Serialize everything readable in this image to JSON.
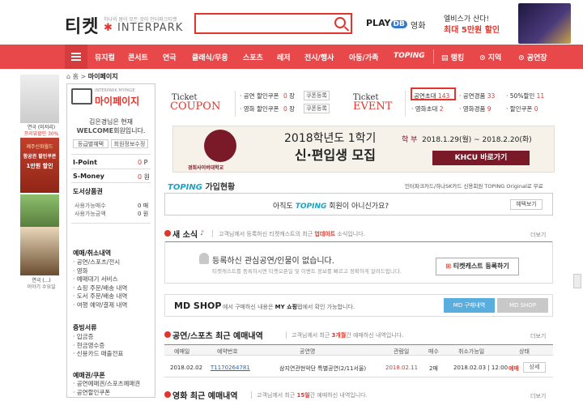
{
  "header": {
    "logo": "티켓",
    "logo_sub": "하나의 몸이 모든 것이 인터파크티켓",
    "logo_brand": "INTERPARK",
    "playdb": "PLAY",
    "playdb_badge": "DB",
    "movie": "영화",
    "ad_line1": "엘비스가 산다!",
    "ad_line2": "최대 5만원 할인"
  },
  "nav": {
    "items": [
      "뮤지컬",
      "콘서트",
      "연극",
      "클래식/무용",
      "스포츠",
      "레저",
      "전시/행사",
      "아동/가족",
      "TOPING"
    ],
    "right": [
      "랭킹",
      "지역",
      "공연장"
    ]
  },
  "breadcrumb": {
    "home": "홈",
    "current": "마이페이지"
  },
  "mypage": {
    "title_small": "INTERPARK MYPAGE",
    "title": "마이페이지",
    "user_line": "김은경님은 현재",
    "grade": "WELCOME",
    "grade_suffix": "회원입니다.",
    "btn1": "등급별혜택",
    "btn2": "회원정보수정",
    "ipoint_label": "I-Point",
    "ipoint_value": "0",
    "ipoint_unit": "P",
    "smoney_label": "S-Money",
    "smoney_value": "0",
    "smoney_unit": "원",
    "voucher_label": "도서상품권",
    "voucher_value": "0",
    "avail_label": "사용가능매수",
    "avail_value": "0",
    "avail_unit": "매",
    "amount_label": "사용가능금액",
    "amount_value": "0",
    "amount_unit": "원",
    "menu_sections": [
      {
        "title": "예매/취소내역",
        "items": [
          "공연/스포츠/전시",
          "영화",
          "예매대기 서비스",
          "쇼핑 주문/배송 내역",
          "도서 주문/배송 내역",
          "여행 예약/결제 내역"
        ]
      },
      {
        "title": "증빙서류",
        "items": [
          "입금증",
          "현금영수증",
          "신용카드 매출전표"
        ]
      },
      {
        "title": "예매권/쿠폰",
        "items": [
          "공연예매권/스포츠예매권",
          "공연할인쿠폰"
        ]
      }
    ]
  },
  "left_banners": {
    "b1_line1": "연극 (미저리)",
    "b1_line2": "프리뷰할인 30%",
    "b2_line1": "제주신화월드",
    "b2_line2": "항공권 할인쿠폰",
    "b2_line3": "1만원 할인",
    "b4_line1": "연극 (...)",
    "b4_line2": "이야기 수요일"
  },
  "coupon": {
    "title1": "Ticket",
    "title2": "COUPON",
    "rows": [
      {
        "label": "공연 할인쿠폰",
        "value": "0",
        "unit": "장",
        "btn": "쿠폰등록"
      },
      {
        "label": "영화 할인쿠폰",
        "value": "0",
        "unit": "장",
        "btn": "쿠폰등록"
      }
    ]
  },
  "event": {
    "title1": "Ticket",
    "title2": "EVENT",
    "items": [
      {
        "label": "공연초대",
        "value": "143"
      },
      {
        "label": "공연경품",
        "value": "33"
      },
      {
        "label": "50%할인",
        "value": "11"
      },
      {
        "label": "영화초대",
        "value": "2"
      },
      {
        "label": "영화경품",
        "value": "9"
      },
      {
        "label": "할인쿠폰",
        "value": "0"
      }
    ]
  },
  "banner": {
    "title": "2018학년도 1학기",
    "subtitle": "신·편입생 모집",
    "school": "경희사이버대학교",
    "school_en": "KYUNG HEE CYBER UNIVERSITY",
    "date_label": "학 부",
    "date": "2018.1.29(월) ~ 2018.2.20(화)",
    "cta": "KHCU 바로가기"
  },
  "toping": {
    "title_brand": "TOPING",
    "title": "가입현황",
    "right_text": "인터파크카드/하나SK카드 신용회원 TOPING Original로 무료",
    "msg_prefix": "아직도",
    "msg_brand": "TOPING",
    "msg_suffix": "회원이 아니신가요?",
    "btn": "혜택보기"
  },
  "news": {
    "title": "새 소식",
    "desc": "고객님께서 등록하신 티켓캐스트의 최근",
    "desc_hl": "업데이트",
    "desc_end": "소식입니다.",
    "more": "더보기",
    "empty": "등록하신 관심공연/인물이 없습니다.",
    "empty_sub": "티켓캐스트를 등록하시면 티켓오픈일 및 이벤트 정보를 빠르고 정확하게 알려드립니다.",
    "btn": "티켓캐스트 등록하기"
  },
  "mdshop": {
    "title": "MD SHOP",
    "desc": "에서 구매하신 내용은",
    "desc_hl": "MY 쇼핑",
    "desc_end": "탭에서 확인 가능합니다.",
    "tab1": "MD 구매내역",
    "tab2": "MD SHOP"
  },
  "recent": {
    "title": "공연/스포츠 최근 예매내역",
    "desc": "고객님께서 최근",
    "count": "3개월",
    "desc_end": "간 예매하신 내역입니다.",
    "more": "더보기",
    "headers": [
      "예매일",
      "예약번호",
      "공연명",
      "관람일",
      "매수",
      "취소가능일",
      "상태"
    ],
    "rows": [
      {
        "date": "2018.02.02",
        "no": "T1170264781",
        "name": "삼지연관현악단 특별공연(2/11서울)",
        "view": "2018.02.11",
        "qty": "2매",
        "cancel": "2018.02.03 | 12:00",
        "status": "예매",
        "btn": "상세"
      }
    ]
  },
  "movie_recent": {
    "title": "영화 최근 예매내역",
    "desc": "고객님께서 최근",
    "count": "15일",
    "desc_end": "간 예매하신 내역입니다.",
    "more": "더보기"
  },
  "colors": {
    "accent": "#e8484a",
    "link": "#2a67b1",
    "toping": "#1ba3c6"
  }
}
